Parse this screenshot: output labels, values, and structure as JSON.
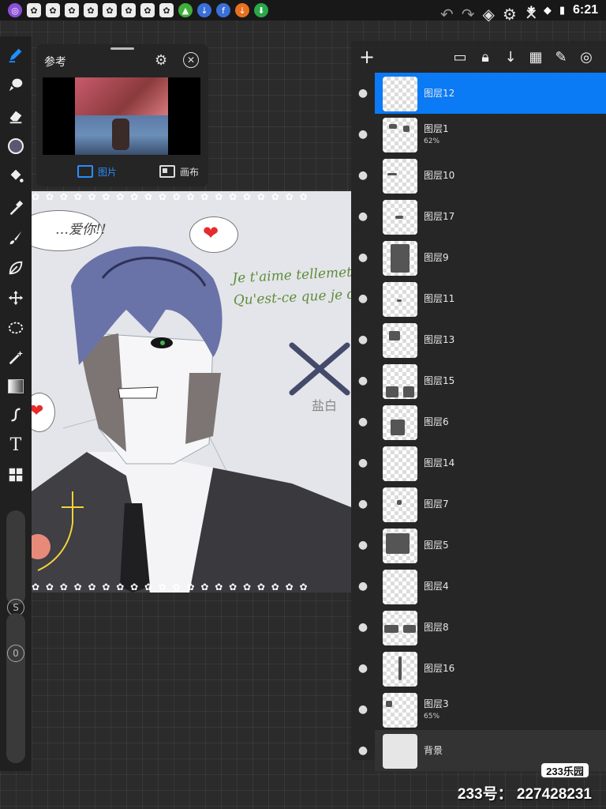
{
  "status_bar": {
    "time": "6:21",
    "notification_icons": [
      "app-icon",
      "paw-icon",
      "paw-icon",
      "paw-icon",
      "paw-icon",
      "paw-icon",
      "paw-icon",
      "paw-icon",
      "paw-icon",
      "green-app-icon",
      "blue-app-icon",
      "blue-app-icon",
      "orange-app-icon",
      "download-icon"
    ]
  },
  "reference_panel": {
    "title": "参考",
    "tabs": [
      {
        "label": "图片",
        "active": true
      },
      {
        "label": "画布",
        "active": false
      }
    ]
  },
  "canvas": {
    "love_text": "…爱你!!",
    "french_text_line1": "Je t'aime tellemet.",
    "french_text_line2": "Qu'est-ce que je dois",
    "signature": "盐白",
    "flower_row": "✿ ✿ ✿ ✿ ✿ ✿ ✿ ✿ ✿ ✿ ✿ ✿ ✿ ✿ ✿ ✿ ✿ ✿ ✿ ✿"
  },
  "layers": [
    {
      "name": "图层12",
      "opacity": "",
      "selected": true
    },
    {
      "name": "图层1",
      "opacity": "62%",
      "selected": false
    },
    {
      "name": "图层10",
      "opacity": "",
      "selected": false
    },
    {
      "name": "图层17",
      "opacity": "",
      "selected": false
    },
    {
      "name": "图层9",
      "opacity": "",
      "selected": false
    },
    {
      "name": "图层11",
      "opacity": "",
      "selected": false
    },
    {
      "name": "图层13",
      "opacity": "",
      "selected": false
    },
    {
      "name": "图层15",
      "opacity": "",
      "selected": false
    },
    {
      "name": "图层6",
      "opacity": "",
      "selected": false
    },
    {
      "name": "图层14",
      "opacity": "",
      "selected": false
    },
    {
      "name": "图层7",
      "opacity": "",
      "selected": false
    },
    {
      "name": "图层5",
      "opacity": "",
      "selected": false
    },
    {
      "name": "图层4",
      "opacity": "",
      "selected": false
    },
    {
      "name": "图层8",
      "opacity": "",
      "selected": false
    },
    {
      "name": "图层16",
      "opacity": "",
      "selected": false
    },
    {
      "name": "图层3",
      "opacity": "65%",
      "selected": false
    }
  ],
  "background_layer": {
    "name": "背景"
  },
  "sliders": {
    "size_badge": "S",
    "opacity_badge": "0"
  },
  "watermark": {
    "logo": "233乐园",
    "id_text": "233号： 227428231"
  },
  "colors": {
    "accent": "#0a7af5",
    "current_brush_color": "#5b5672"
  }
}
